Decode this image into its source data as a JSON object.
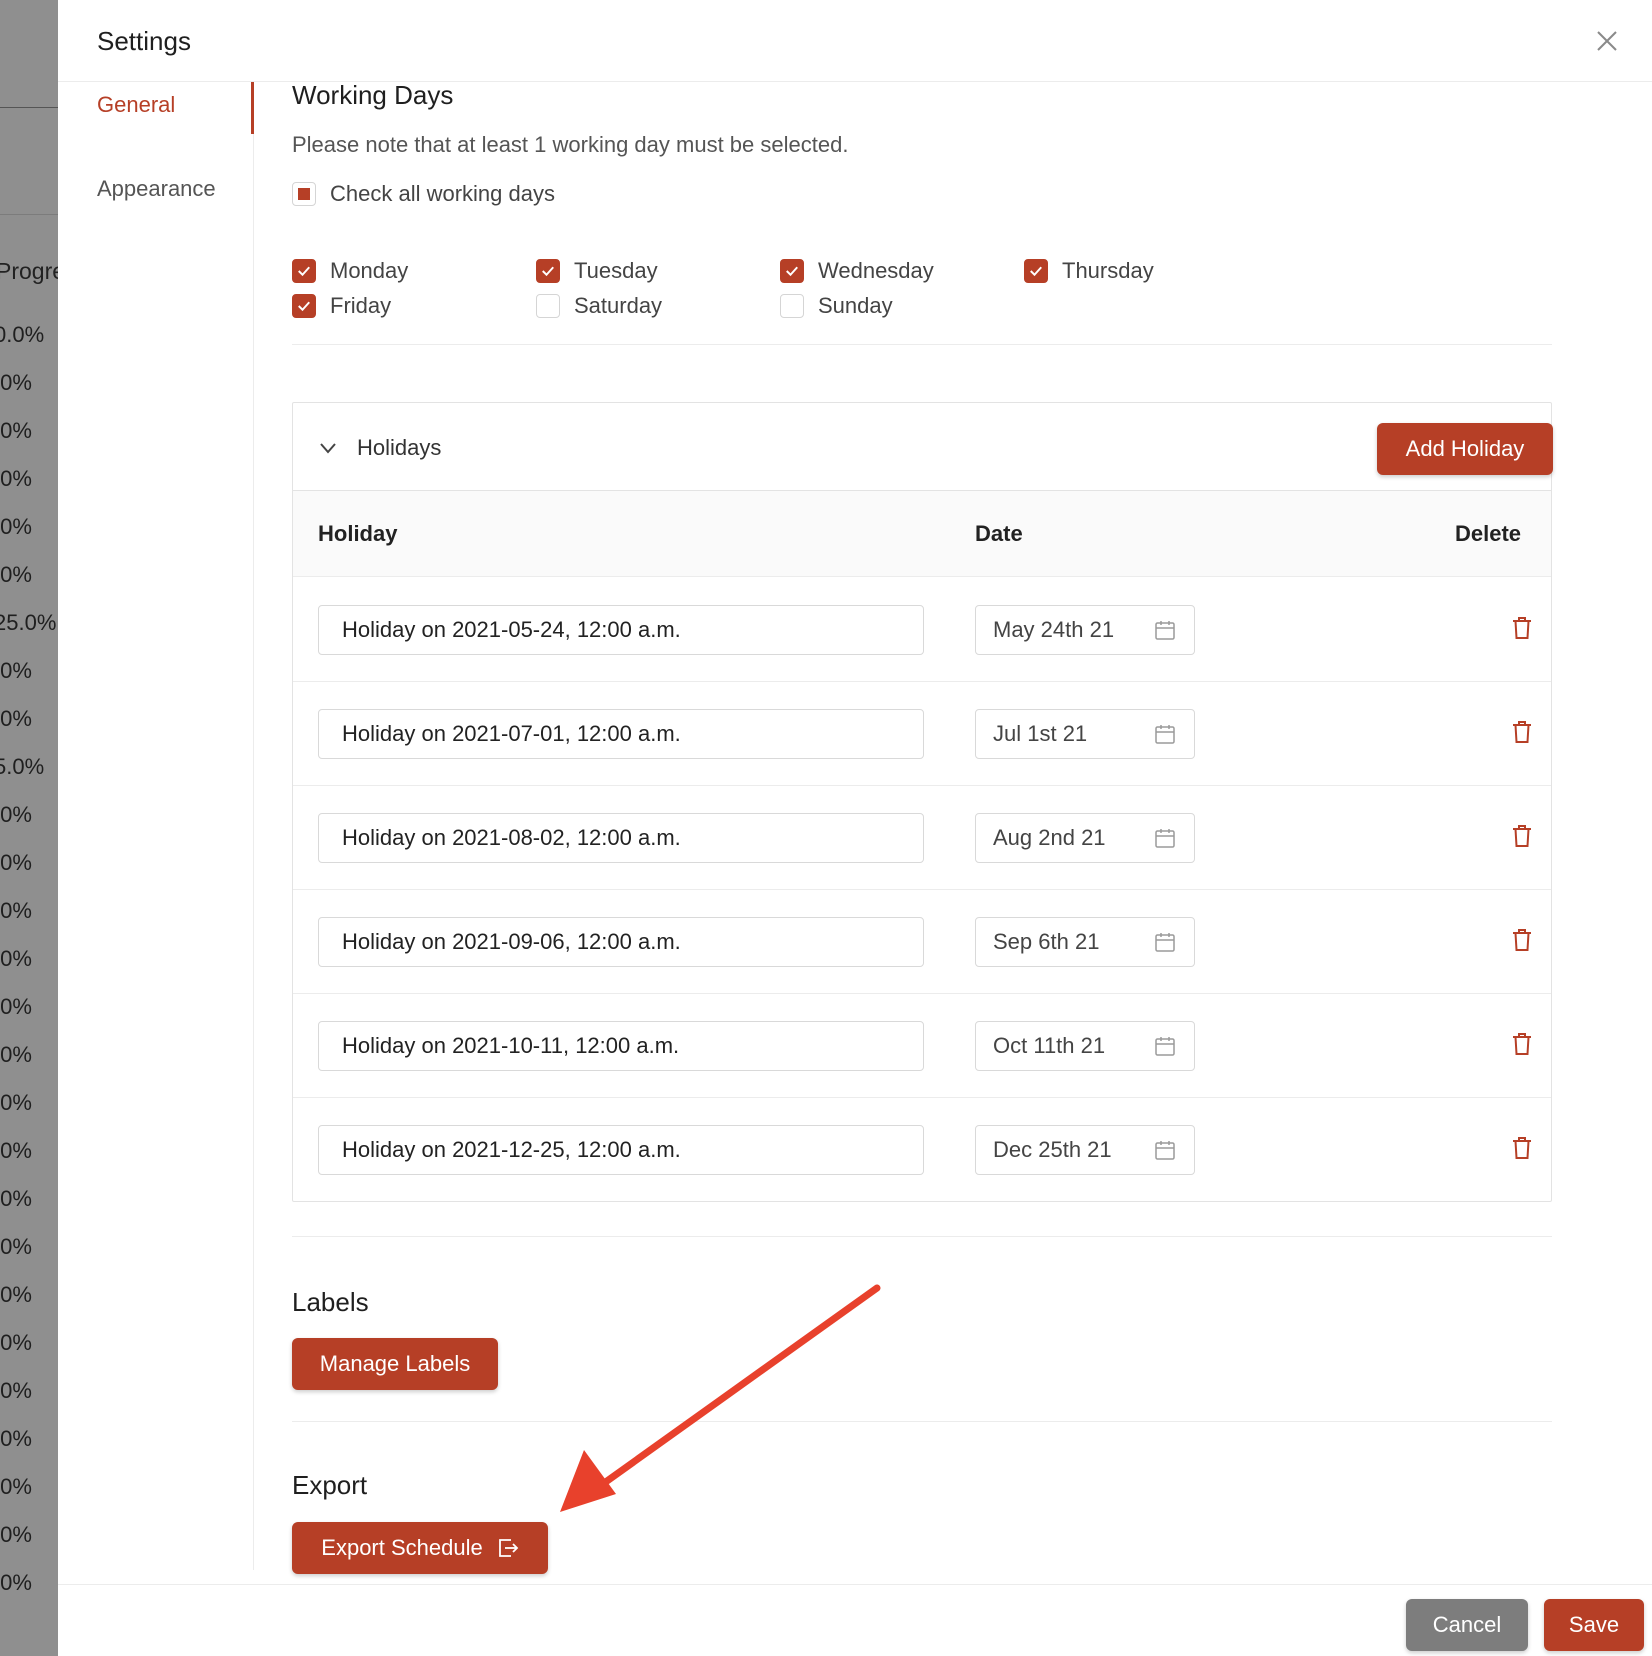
{
  "background": {
    "column_title": "Progre",
    "cells": [
      "0.0%",
      ".0%",
      ".0%",
      ".0%",
      ".0%",
      ".0%",
      "25.0%",
      ".0%",
      ".0%",
      "5.0%",
      ".0%",
      ".0%",
      ".0%",
      ".0%",
      ".0%",
      ".0%",
      ".0%",
      ".0%",
      ".0%",
      ".0%",
      ".0%",
      ".0%",
      ".0%",
      ".0%",
      ".0%",
      ".0%",
      ".0%"
    ]
  },
  "modal": {
    "title": "Settings",
    "close_icon": "close-icon"
  },
  "nav": {
    "items": [
      {
        "label": "General",
        "active": true
      },
      {
        "label": "Appearance",
        "active": false
      }
    ]
  },
  "working_days": {
    "title": "Working Days",
    "note": "Please note that at least 1 working day must be selected.",
    "check_all_label": "Check all working days",
    "days": [
      {
        "label": "Monday",
        "checked": true
      },
      {
        "label": "Tuesday",
        "checked": true
      },
      {
        "label": "Wednesday",
        "checked": true
      },
      {
        "label": "Thursday",
        "checked": true
      },
      {
        "label": "Friday",
        "checked": true
      },
      {
        "label": "Saturday",
        "checked": false
      },
      {
        "label": "Sunday",
        "checked": false
      }
    ]
  },
  "holidays": {
    "title": "Holidays",
    "add_label": "Add Holiday",
    "columns": {
      "holiday": "Holiday",
      "date": "Date",
      "delete": "Delete"
    },
    "rows": [
      {
        "name": "Holiday on 2021-05-24, 12:00 a.m.",
        "date": "May 24th 21"
      },
      {
        "name": "Holiday on 2021-07-01, 12:00 a.m.",
        "date": "Jul 1st 21"
      },
      {
        "name": "Holiday on 2021-08-02, 12:00 a.m.",
        "date": "Aug 2nd 21"
      },
      {
        "name": "Holiday on 2021-09-06, 12:00 a.m.",
        "date": "Sep 6th 21"
      },
      {
        "name": "Holiday on 2021-10-11, 12:00 a.m.",
        "date": "Oct 11th 21"
      },
      {
        "name": "Holiday on 2021-12-25, 12:00 a.m.",
        "date": "Dec 25th 21"
      }
    ]
  },
  "labels": {
    "title": "Labels",
    "manage_label": "Manage Labels"
  },
  "export": {
    "title": "Export",
    "button_label": "Export Schedule",
    "icon": "export-icon"
  },
  "footer": {
    "cancel_label": "Cancel",
    "save_label": "Save"
  },
  "colors": {
    "accent": "#b63f26",
    "cancel": "#7d7d7d",
    "annotation_arrow": "#e8412c"
  }
}
